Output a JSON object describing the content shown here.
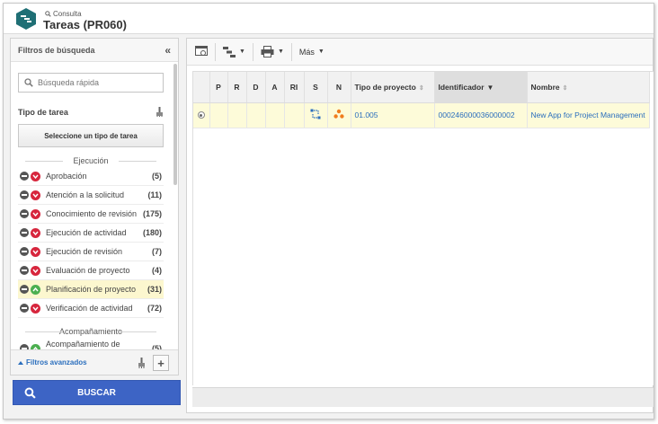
{
  "header": {
    "breadcrumb": "Consulta",
    "title": "Tareas (PR060)"
  },
  "filters": {
    "panel_title": "Filtros de búsqueda",
    "quick_search_placeholder": "Búsqueda rápida",
    "task_type_label": "Tipo de tarea",
    "select_task_type_button": "Seleccione un tipo de tarea",
    "groups": [
      {
        "label": "Ejecución",
        "items": [
          {
            "label": "Aprobación",
            "count": "(5)",
            "state": "red"
          },
          {
            "label": "Atención a la solicitud",
            "count": "(11)",
            "state": "red"
          },
          {
            "label": "Conocimiento de revisión",
            "count": "(175)",
            "state": "red"
          },
          {
            "label": "Ejecución de actividad",
            "count": "(180)",
            "state": "red"
          },
          {
            "label": "Ejecución de revisión",
            "count": "(7)",
            "state": "red"
          },
          {
            "label": "Evaluación de proyecto",
            "count": "(4)",
            "state": "red"
          },
          {
            "label": "Planificación de proyecto",
            "count": "(31)",
            "state": "green"
          },
          {
            "label": "Verificación de actividad",
            "count": "(72)",
            "state": "red"
          }
        ]
      },
      {
        "label": "Acompañamiento",
        "items": [
          {
            "label": "Acompañamiento de",
            "count": "(5)",
            "state": "green"
          }
        ]
      }
    ],
    "advanced_filters_link": "Filtros avanzados",
    "search_button": "BUSCAR"
  },
  "toolbar": {
    "more_label": "Más"
  },
  "grid": {
    "columns": [
      "P",
      "R",
      "D",
      "A",
      "RI",
      "S",
      "N",
      "Tipo de proyecto",
      "Identificador",
      "Nombre"
    ],
    "rows": [
      {
        "tipo_de_proyecto": "01.005",
        "identificador": "000246000036000002",
        "nombre": "New App for Project Management"
      }
    ]
  },
  "colors": {
    "accent": "#3d64c5",
    "link": "#2a6ebd",
    "selected_row": "#fdfbd9",
    "danger": "#d7263d",
    "success": "#4caf50",
    "logo": "#1f6f75"
  }
}
